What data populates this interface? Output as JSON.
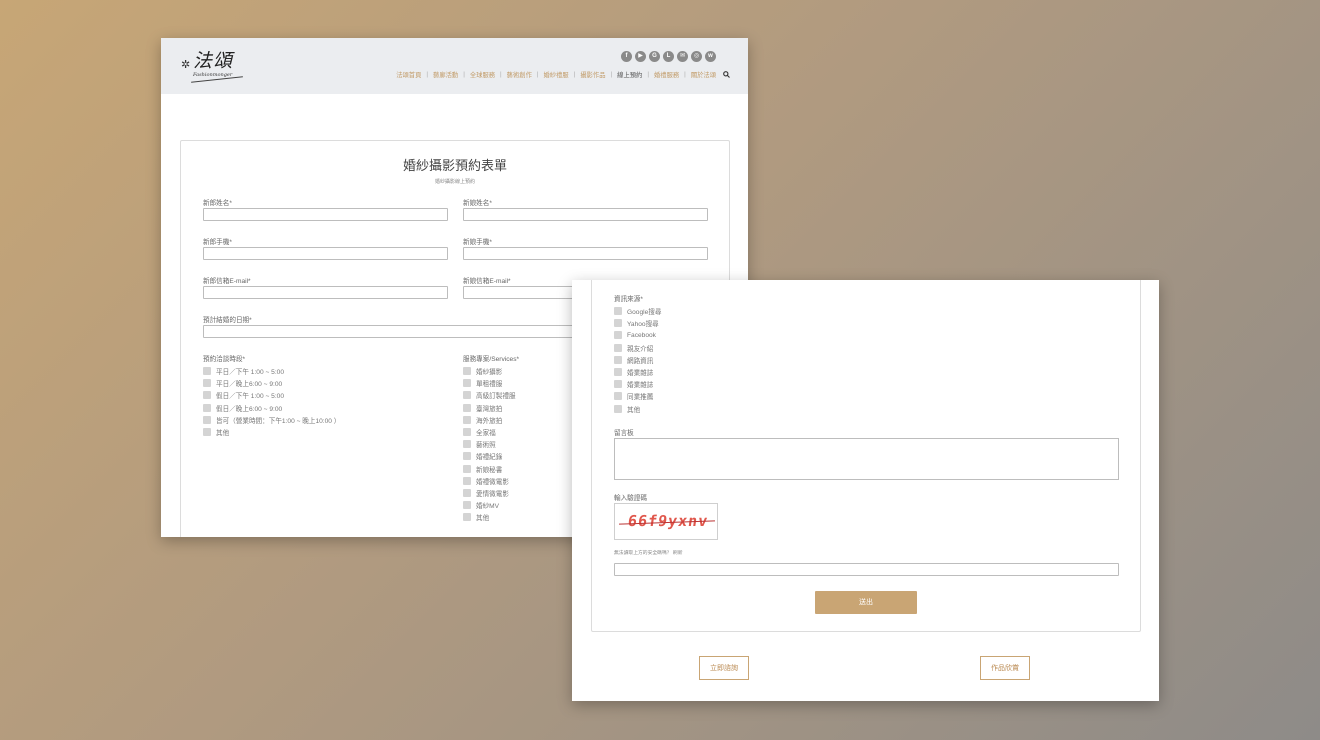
{
  "header": {
    "logo_text": "法頌",
    "logo_subtext": "Fashionmonger",
    "social_icons": [
      "facebook-icon",
      "youtube-icon",
      "google-plus-icon",
      "line-icon",
      "email-icon",
      "instagram-icon",
      "weibo-icon"
    ],
    "nav": [
      "法頌首頁",
      "藝廊活動",
      "全球服務",
      "藝術創作",
      "婚紗禮服",
      "攝影作品",
      "線上預約",
      "婚禮服務",
      "關於法頌"
    ],
    "nav_active_index": 6
  },
  "form": {
    "title": "婚紗攝影預約表單",
    "subtitle": "婚紗攝影線上預約",
    "groom_name_label": "新郎姓名*",
    "bride_name_label": "新娘姓名*",
    "groom_phone_label": "新郎手機*",
    "bride_phone_label": "新娘手機*",
    "groom_email_label": "新郎信箱E-mail*",
    "bride_email_label": "新娘信箱E-mail*",
    "wedding_date_label": "預計結婚的日期*",
    "time_label": "預約洽談時段*",
    "time_options": [
      "平日／下午 1:00 ~ 5:00",
      "平日／晚上6:00 ~ 9:00",
      "假日／下午 1:00 ~ 5:00",
      "假日／晚上6:00 ~ 9:00",
      "皆可（營業時間：下午1:00 ~ 晚上10:00 ）",
      "其他"
    ],
    "services_label": "服務專案/Services*",
    "services_options": [
      "婚紗攝影",
      "單租禮服",
      "高級訂製禮服",
      "臺灣旅拍",
      "海外旅拍",
      "全家福",
      "藝術照",
      "婚禮紀錄",
      "新娘秘書",
      "婚禮微電影",
      "愛情微電影",
      "婚紗MV",
      "其他"
    ],
    "source_label": "資訊來源*",
    "source_options": [
      "Google搜尋",
      "Yahoo搜尋",
      "Facebook",
      "親友介紹",
      "網路資訊",
      "婚業雜誌",
      "婚業雜誌",
      "同業推薦",
      "其他"
    ],
    "message_label": "留言板",
    "captcha_label": "輸入驗證碼",
    "captcha_text": "66f9yxnv",
    "captcha_note": "無法讀取上方的安全碼嗎？ 刷新",
    "submit_label": "送出"
  },
  "footer_buttons": {
    "inquiry_label": "立即諮詢",
    "portfolio_label": "作品欣賞"
  }
}
